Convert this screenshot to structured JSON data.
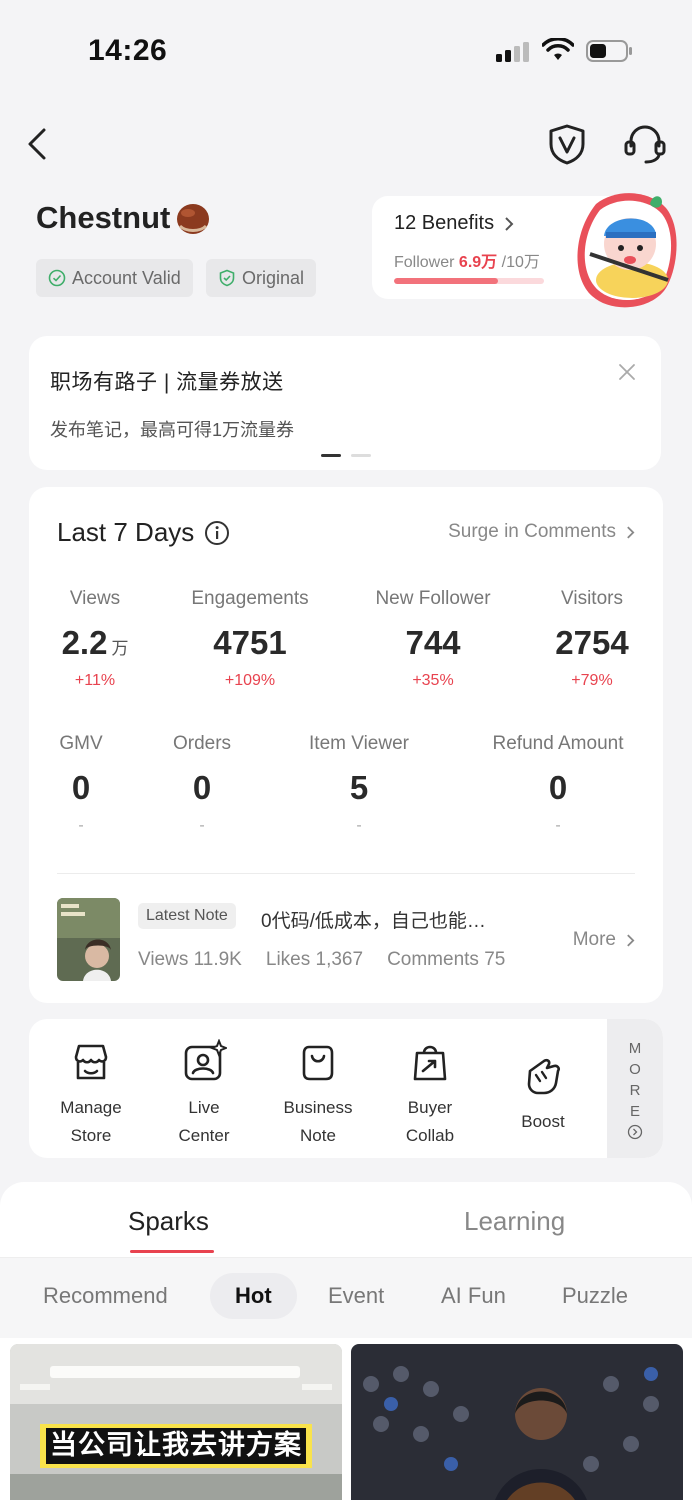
{
  "status_bar": {
    "time": "14:26"
  },
  "profile": {
    "name": "Chestnut",
    "badges": [
      "Account Valid",
      "Original"
    ]
  },
  "benefits": {
    "title": "12 Benefits",
    "follower_label": "Follower",
    "follower_current": "6.9万",
    "follower_target": "/10万",
    "progress": 0.69
  },
  "promo": {
    "title": "职场有路子 | 流量券放送",
    "subtitle": "发布笔记，最高可得1万流量券"
  },
  "stats": {
    "title": "Last 7 Days",
    "surge_label": "Surge in Comments",
    "row1": [
      {
        "label": "Views",
        "value": "2.2",
        "unit": "万",
        "delta": "+11%"
      },
      {
        "label": "Engagements",
        "value": "4751",
        "unit": "",
        "delta": "+109%"
      },
      {
        "label": "New Follower",
        "value": "744",
        "unit": "",
        "delta": "+35%"
      },
      {
        "label": "Visitors",
        "value": "2754",
        "unit": "",
        "delta": "+79%"
      }
    ],
    "row2": [
      {
        "label": "GMV",
        "value": "0",
        "delta": "-"
      },
      {
        "label": "Orders",
        "value": "0",
        "delta": "-"
      },
      {
        "label": "Item Viewer",
        "value": "5",
        "delta": "-"
      },
      {
        "label": "Refund Amount",
        "value": "0",
        "delta": "-"
      }
    ],
    "latest_note": {
      "tag": "Latest Note",
      "title": "0代码/低成本，自己也能…",
      "views": "Views 11.9K",
      "likes": "Likes 1,367",
      "comments": "Comments 75",
      "more": "More"
    }
  },
  "tools": {
    "items": [
      {
        "line1": "Manage",
        "line2": "Store",
        "icon": "store-icon"
      },
      {
        "line1": "Live",
        "line2": "Center",
        "icon": "live-icon"
      },
      {
        "line1": "Business",
        "line2": "Note",
        "icon": "bag-icon"
      },
      {
        "line1": "Buyer",
        "line2": "Collab",
        "icon": "collab-icon"
      },
      {
        "line1": "Boost",
        "line2": "",
        "icon": "fist-icon"
      }
    ],
    "more_letters": [
      "M",
      "O",
      "R",
      "E"
    ]
  },
  "bottom": {
    "tabs": [
      "Sparks",
      "Learning"
    ],
    "chips": [
      "Recommend",
      "Hot",
      "Event",
      "AI Fun",
      "Puzzle"
    ],
    "active_chip": "Hot",
    "video1_caption": "当公司让我去讲方案"
  },
  "colors": {
    "accent": "#e8434f",
    "check": "#3fae6a"
  }
}
